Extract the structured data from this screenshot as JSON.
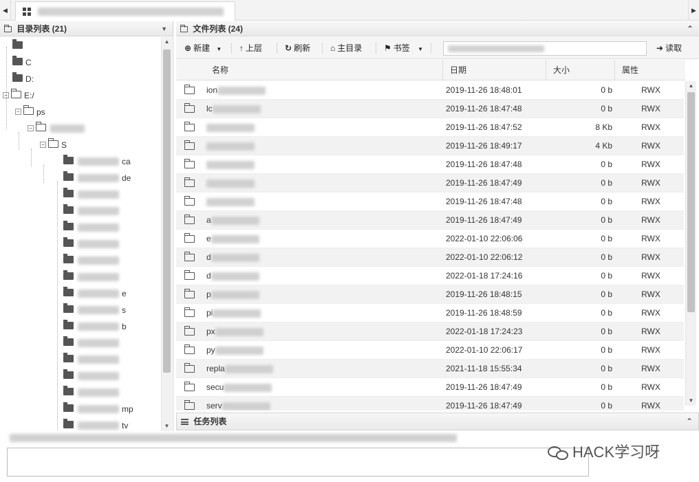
{
  "tabbar": {
    "tab_title": ""
  },
  "left_panel": {
    "title": "目录列表 (21)",
    "tree": [
      {
        "label": "",
        "level": 0,
        "kind": "dark"
      },
      {
        "label": "C",
        "level": 0,
        "kind": "dark"
      },
      {
        "label": "D:",
        "level": 0,
        "kind": "dark"
      },
      {
        "label": "E:/",
        "level": 0,
        "kind": "open",
        "toggle": "−"
      },
      {
        "label": "ps",
        "level": 1,
        "kind": "open",
        "toggle": "−"
      },
      {
        "label": "",
        "level": 2,
        "kind": "open",
        "toggle": "−"
      },
      {
        "label": "S",
        "level": 3,
        "kind": "open",
        "toggle": "−"
      },
      {
        "label": "ca",
        "level": 4,
        "kind": "dark"
      },
      {
        "label": "de",
        "level": 4,
        "kind": "dark"
      },
      {
        "label": "",
        "level": 4,
        "kind": "dark"
      },
      {
        "label": "",
        "level": 4,
        "kind": "dark"
      },
      {
        "label": "",
        "level": 4,
        "kind": "dark"
      },
      {
        "label": "",
        "level": 4,
        "kind": "dark"
      },
      {
        "label": "",
        "level": 4,
        "kind": "dark"
      },
      {
        "label": "",
        "level": 4,
        "kind": "dark"
      },
      {
        "label": "e",
        "level": 4,
        "kind": "dark"
      },
      {
        "label": "s",
        "level": 4,
        "kind": "dark"
      },
      {
        "label": "b",
        "level": 4,
        "kind": "dark"
      },
      {
        "label": "",
        "level": 4,
        "kind": "dark"
      },
      {
        "label": "",
        "level": 4,
        "kind": "dark"
      },
      {
        "label": "",
        "level": 4,
        "kind": "dark"
      },
      {
        "label": "",
        "level": 4,
        "kind": "dark"
      },
      {
        "label": "mp",
        "level": 4,
        "kind": "dark"
      },
      {
        "label": "tv",
        "level": 4,
        "kind": "dark"
      }
    ]
  },
  "right_panel": {
    "title": "文件列表 (24)",
    "toolbar": {
      "new_label": "新建",
      "up_label": "上层",
      "refresh_label": "刷新",
      "home_label": "主目录",
      "bookmark_label": "书签",
      "path_value": "",
      "read_label": "读取"
    },
    "columns": {
      "name": "名称",
      "date": "日期",
      "size": "大小",
      "attr": "属性"
    },
    "rows": [
      {
        "name": "ion",
        "date": "2019-11-26 18:48:01",
        "size": "0 b",
        "attr": "RWX"
      },
      {
        "name": "lc",
        "date": "2019-11-26 18:47:48",
        "size": "0 b",
        "attr": "RWX"
      },
      {
        "name": "",
        "date": "2019-11-26 18:47:52",
        "size": "8 Kb",
        "attr": "RWX"
      },
      {
        "name": "",
        "date": "2019-11-26 18:49:17",
        "size": "4 Kb",
        "attr": "RWX"
      },
      {
        "name": "",
        "date": "2019-11-26 18:47:48",
        "size": "0 b",
        "attr": "RWX"
      },
      {
        "name": "",
        "date": "2019-11-26 18:47:49",
        "size": "0 b",
        "attr": "RWX"
      },
      {
        "name": "",
        "date": "2019-11-26 18:47:48",
        "size": "0 b",
        "attr": "RWX"
      },
      {
        "name": "a",
        "date": "2019-11-26 18:47:49",
        "size": "0 b",
        "attr": "RWX"
      },
      {
        "name": "e",
        "date": "2022-01-10 22:06:06",
        "size": "0 b",
        "attr": "RWX"
      },
      {
        "name": "d",
        "date": "2022-01-10 22:06:12",
        "size": "0 b",
        "attr": "RWX"
      },
      {
        "name": "d",
        "date": "2022-01-18 17:24:16",
        "size": "0 b",
        "attr": "RWX"
      },
      {
        "name": "p",
        "date": "2019-11-26 18:48:15",
        "size": "0 b",
        "attr": "RWX"
      },
      {
        "name": "pi",
        "date": "2019-11-26 18:48:59",
        "size": "0 b",
        "attr": "RWX"
      },
      {
        "name": "px",
        "date": "2022-01-18 17:24:23",
        "size": "0 b",
        "attr": "RWX"
      },
      {
        "name": "py",
        "date": "2022-01-10 22:06:17",
        "size": "0 b",
        "attr": "RWX"
      },
      {
        "name": "repla",
        "date": "2021-11-18 15:55:34",
        "size": "0 b",
        "attr": "RWX"
      },
      {
        "name": "secu",
        "date": "2019-11-26 18:47:49",
        "size": "0 b",
        "attr": "RWX"
      },
      {
        "name": "serv",
        "date": "2019-11-26 18:47:49",
        "size": "0 b",
        "attr": "RWX"
      }
    ]
  },
  "task_panel": {
    "title": "任务列表"
  },
  "watermark": {
    "text": "HACK学习呀"
  }
}
